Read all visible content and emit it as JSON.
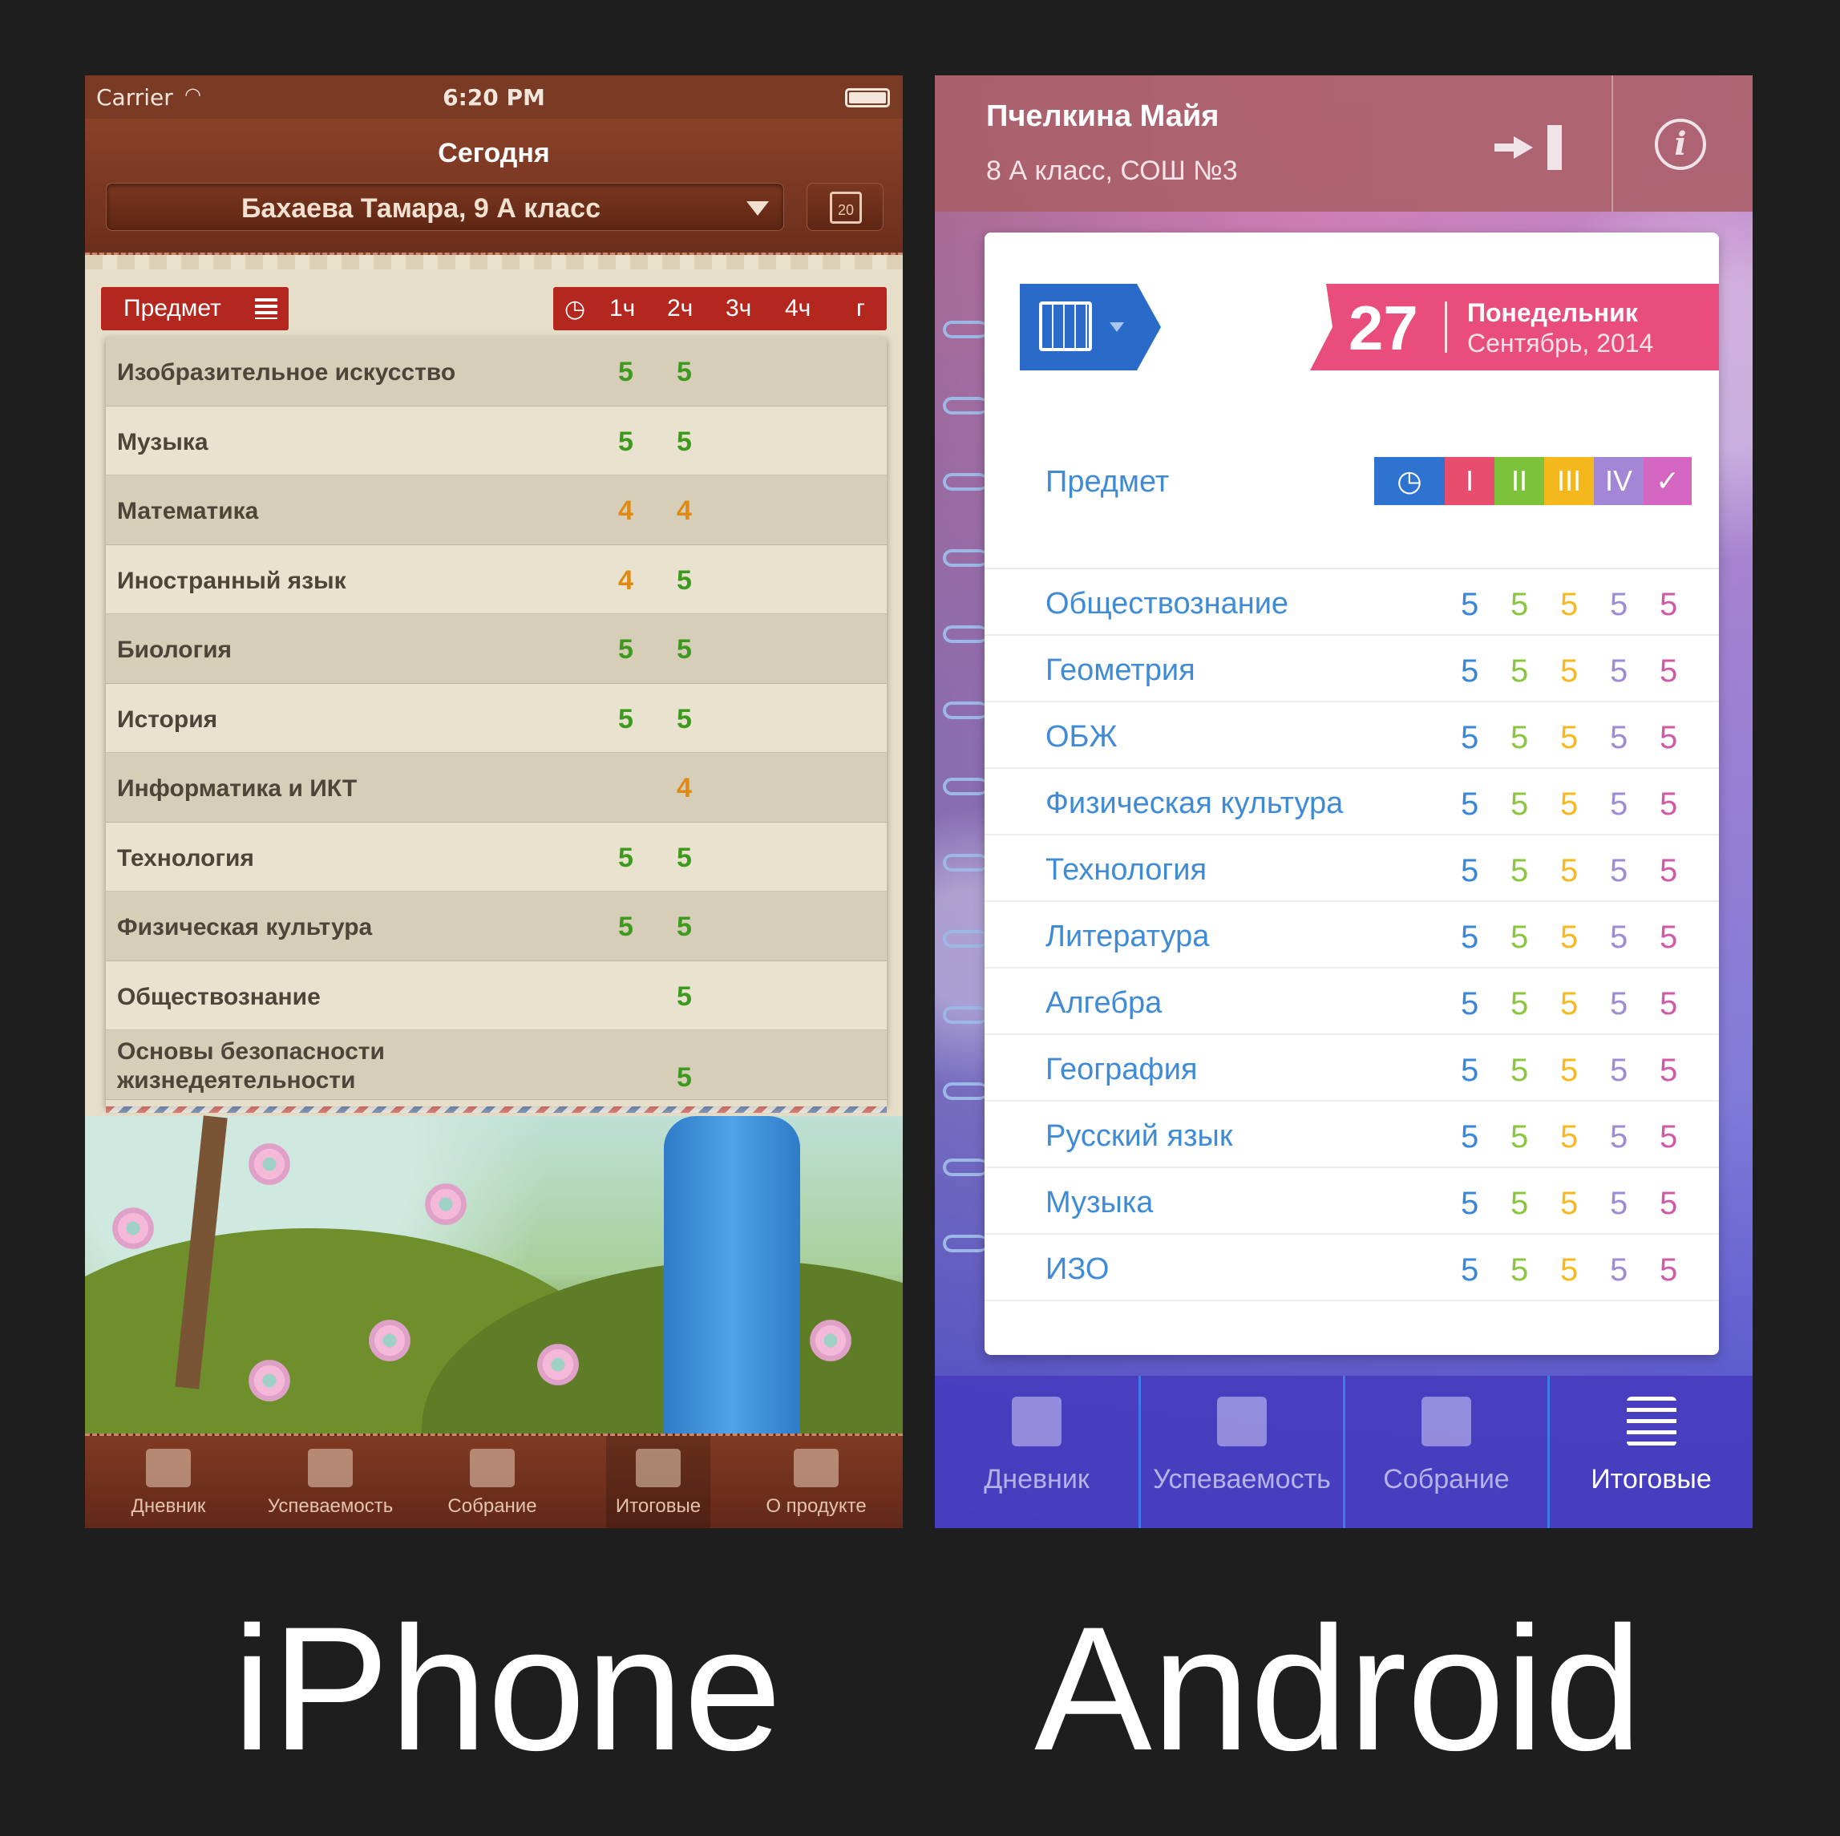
{
  "iphone": {
    "status": {
      "carrier": "Carrier",
      "time": "6:20 PM"
    },
    "title": "Сегодня",
    "student": "Бахаева Тамара, 9 А класс",
    "calendar_day": "20",
    "columns": {
      "subject": "Предмет",
      "terms": [
        "1ч",
        "2ч",
        "3ч",
        "4ч",
        "г"
      ]
    },
    "rows": [
      {
        "name": "Изобразительное искусство",
        "g1": "5",
        "g2": "5"
      },
      {
        "name": "Музыка",
        "g1": "5",
        "g2": "5"
      },
      {
        "name": "Математика",
        "g1": "4",
        "g2": "4"
      },
      {
        "name": "Иностранный язык",
        "g1": "4",
        "g2": "5"
      },
      {
        "name": "Биология",
        "g1": "5",
        "g2": "5"
      },
      {
        "name": "История",
        "g1": "5",
        "g2": "5"
      },
      {
        "name": "Информатика и ИКТ",
        "g1": "",
        "g2": "4"
      },
      {
        "name": "Технология",
        "g1": "5",
        "g2": "5"
      },
      {
        "name": "Физическая культура",
        "g1": "5",
        "g2": "5"
      },
      {
        "name": "Обществознание",
        "g1": "",
        "g2": "5"
      },
      {
        "name": "Основы безопасности жизнедеятельности",
        "g1": "",
        "g2": "5"
      }
    ],
    "tabs": [
      "Дневник",
      "Успеваемость",
      "Собрание",
      "Итоговые",
      "О продукте"
    ],
    "active_tab": "Итоговые",
    "colors": {
      "grade5": "#3e9a1f",
      "grade4": "#e08a14",
      "accent": "#b3271e"
    }
  },
  "android": {
    "student_name": "Пчелкина Майя",
    "student_class": "8 А класс, СОШ №3",
    "date": {
      "day": "27",
      "weekday": "Понедельник",
      "month": "Сентябрь, 2014"
    },
    "subject_header": "Предмет",
    "terms": [
      "I",
      "II",
      "III",
      "IV",
      "✓"
    ],
    "term_colors": [
      "#2f73d0",
      "#e84d6e",
      "#7cc23a",
      "#f5b81c",
      "#a486d6",
      "#d266c0"
    ],
    "grade_colors": [
      "#3a86d9",
      "#8cc63f",
      "#f6b91f",
      "#9f8bd4",
      "#d15aa8"
    ],
    "rows": [
      {
        "name": "Обществознание",
        "grades": [
          "5",
          "5",
          "5",
          "5",
          "5"
        ]
      },
      {
        "name": "Геометрия",
        "grades": [
          "5",
          "5",
          "5",
          "5",
          "5"
        ]
      },
      {
        "name": "ОБЖ",
        "grades": [
          "5",
          "5",
          "5",
          "5",
          "5"
        ]
      },
      {
        "name": "Физическая культура",
        "grades": [
          "5",
          "5",
          "5",
          "5",
          "5"
        ]
      },
      {
        "name": "Технология",
        "grades": [
          "5",
          "5",
          "5",
          "5",
          "5"
        ]
      },
      {
        "name": "Литература",
        "grades": [
          "5",
          "5",
          "5",
          "5",
          "5"
        ]
      },
      {
        "name": "Алгебра",
        "grades": [
          "5",
          "5",
          "5",
          "5",
          "5"
        ]
      },
      {
        "name": "География",
        "grades": [
          "5",
          "5",
          "5",
          "5",
          "5"
        ]
      },
      {
        "name": "Русский язык",
        "grades": [
          "5",
          "5",
          "5",
          "5",
          "5"
        ]
      },
      {
        "name": "Музыка",
        "grades": [
          "5",
          "5",
          "5",
          "5",
          "5"
        ]
      },
      {
        "name": "ИЗО",
        "grades": [
          "5",
          "5",
          "5",
          "5",
          "5"
        ]
      }
    ],
    "tabs": [
      "Дневник",
      "Успеваемость",
      "Собрание",
      "Итоговые"
    ],
    "active_tab": "Итоговые"
  },
  "captions": {
    "left": "iPhone",
    "right": "Android"
  }
}
